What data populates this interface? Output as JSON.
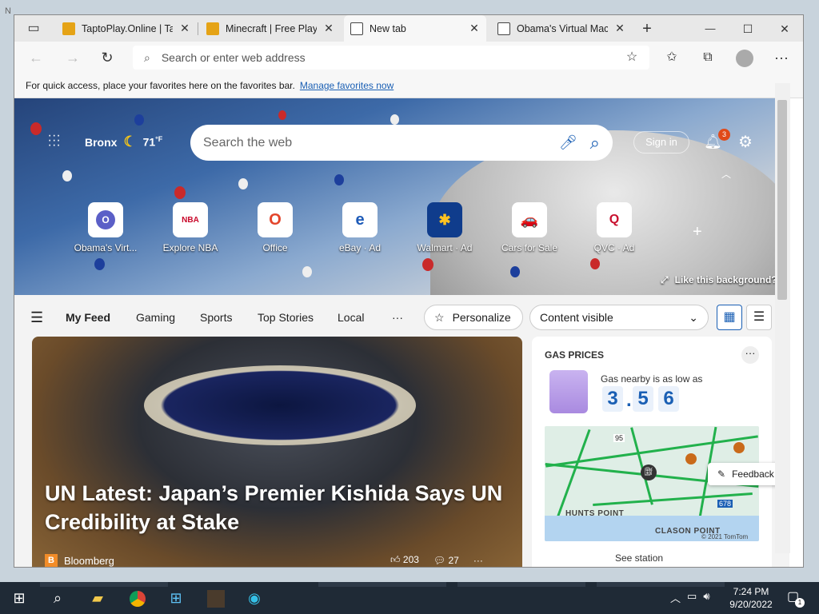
{
  "desktop": {
    "ghost_text": "N"
  },
  "tabs": [
    {
      "title": "TaptoPlay.Online | Tap",
      "color": "#e5a316"
    },
    {
      "title": "Minecraft | Free Play | ",
      "color": "#e5a316"
    },
    {
      "title": "New tab",
      "color": "#ffffff"
    },
    {
      "title": "Obama's Virtual Mach",
      "color": "#ffffff"
    }
  ],
  "window_controls": {
    "minimize": "—",
    "maximize": "☐",
    "close": "✕"
  },
  "address": {
    "placeholder": "Search or enter web address"
  },
  "favbar": {
    "text": "For quick access, place your favorites here on the favorites bar.",
    "link": "Manage favorites now"
  },
  "hero": {
    "location": "Bronx",
    "temp": "71",
    "unit": "°F",
    "search_placeholder": "Search the web",
    "signin": "Sign in",
    "notif_count": "3",
    "like_background": "Like this background?"
  },
  "quick_links": [
    {
      "label": "Obama's Virt...",
      "icon": "O",
      "icon_color": "#5b5fc7"
    },
    {
      "label": "Explore NBA",
      "icon": "NBA",
      "icon_color": "#c9082a"
    },
    {
      "label": "Office",
      "icon": "O",
      "icon_color": "#e3452b"
    },
    {
      "label": "eBay · Ad",
      "icon": "e",
      "icon_color": "#1e5bb8"
    },
    {
      "label": "Walmart · Ad",
      "icon": "✱",
      "icon_color": "#ffc220"
    },
    {
      "label": "Cars for Sale",
      "icon": "🚗",
      "icon_color": "#e04a1a"
    },
    {
      "label": "QVC · Ad",
      "icon": "Q",
      "icon_color": "#c8102e"
    }
  ],
  "feednav": {
    "items": [
      "My Feed",
      "Gaming",
      "Sports",
      "Top Stories",
      "Local"
    ],
    "more": "···",
    "personalize": "Personalize",
    "content_visible": "Content visible"
  },
  "main_story": {
    "headline": "UN Latest: Japan’s Premier Kishida Says UN Credibility at Stake",
    "source": "Bloomberg",
    "reactions": "203",
    "comments": "27",
    "more": "···"
  },
  "gas": {
    "title": "GAS PRICES",
    "nearby": "Gas nearby is as low as",
    "price_digits": [
      "3",
      "5",
      "6"
    ],
    "price_separator": ".",
    "map_labels": {
      "a": "HUNTS POINT",
      "b": "CLASON POINT",
      "copyright": "© 2021 TomTom",
      "route1": "95",
      "route2": "678"
    },
    "see_station": "See station"
  },
  "feedback": "Feedback",
  "taskbar": {
    "time": "7:24 PM",
    "date": "9/20/2022",
    "notif_count": "1"
  }
}
